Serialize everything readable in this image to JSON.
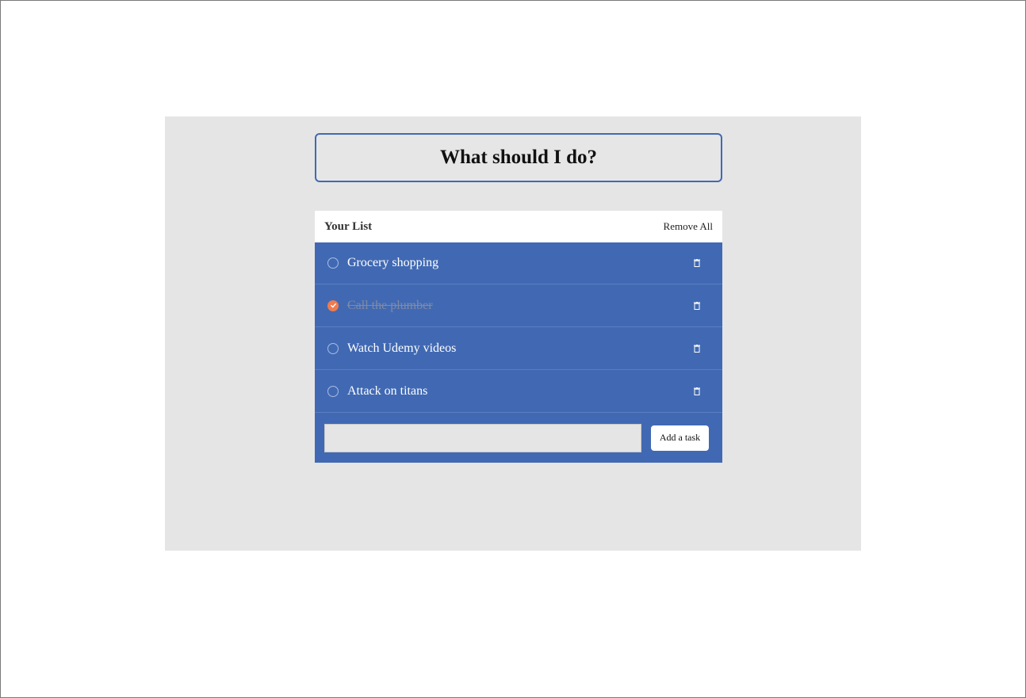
{
  "header": {
    "title": "What should I do?"
  },
  "list": {
    "heading": "Your List",
    "remove_all_label": "Remove All",
    "tasks": [
      {
        "text": "Grocery shopping",
        "completed": false,
        "icon": "trash-icon"
      },
      {
        "text": "Call the plumber",
        "completed": true,
        "icon": "trash-icon"
      },
      {
        "text": "Watch Udemy videos",
        "completed": false,
        "icon": "trash-icon"
      },
      {
        "text": "Attack on titans",
        "completed": false,
        "icon": "trash-icon"
      }
    ]
  },
  "add_task": {
    "input_value": "",
    "input_placeholder": "",
    "button_label": "Add a task"
  },
  "colors": {
    "accent": "#4169b3",
    "completed_check": "#ef7b4f",
    "panel_background": "#e5e5e5"
  }
}
